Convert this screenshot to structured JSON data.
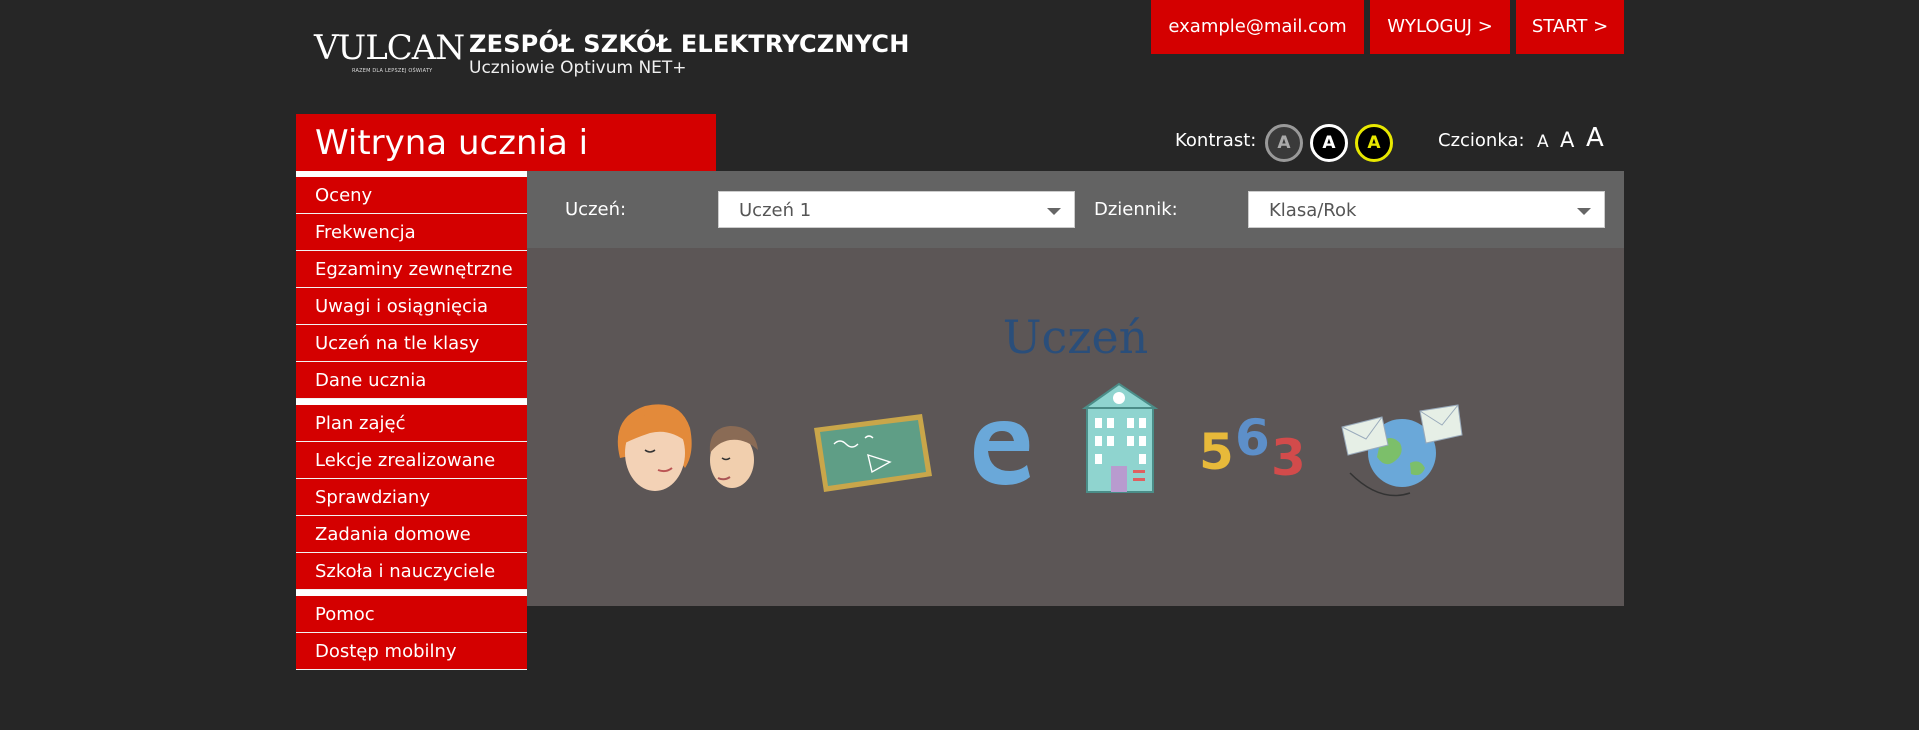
{
  "header": {
    "logo_text": "VULCAN",
    "logo_tagline": "RAZEM DLA LEPSZEJ OŚWIATY",
    "school_name": "ZESPÓŁ SZKÓŁ ELEKTRYCZNYCH",
    "school_subtitle": "Uczniowie Optivum NET+",
    "buttons": {
      "email": "example@mail.com",
      "logout": "WYLOGUJ >",
      "start": "START >"
    }
  },
  "site_title": "Witryna ucznia i rodzica",
  "accessibility": {
    "contrast_label": "Kontrast:",
    "contrast_options": [
      "A",
      "A",
      "A"
    ],
    "font_label": "Czcionka:",
    "font_sizes": [
      "A",
      "A",
      "A"
    ]
  },
  "sidebar": {
    "group1": [
      "Oceny",
      "Frekwencja",
      "Egzaminy zewnętrzne",
      "Uwagi i osiągnięcia",
      "Uczeń na tle klasy",
      "Dane ucznia"
    ],
    "group2": [
      "Plan zajęć",
      "Lekcje zrealizowane",
      "Sprawdziany",
      "Zadania domowe",
      "Szkoła i nauczyciele"
    ],
    "group3": [
      "Pomoc",
      "Dostęp mobilny"
    ]
  },
  "filters": {
    "student_label": "Uczeń:",
    "student_value": "Uczeń 1",
    "journal_label": "Dziennik:",
    "journal_value": "Klasa/Rok"
  },
  "main": {
    "hero_title": "Uczeń",
    "illustrations": [
      "students-icon",
      "chalkboard-icon",
      "e-letter-icon",
      "school-building-icon",
      "numbers-icon",
      "globe-mail-icon"
    ],
    "numbers_text": "563"
  },
  "colors": {
    "background": "#262626",
    "accent_red": "#d40000",
    "panel_gray": "#636363",
    "content_gray": "#5c5656",
    "hero_blue": "#2a4e7a"
  }
}
